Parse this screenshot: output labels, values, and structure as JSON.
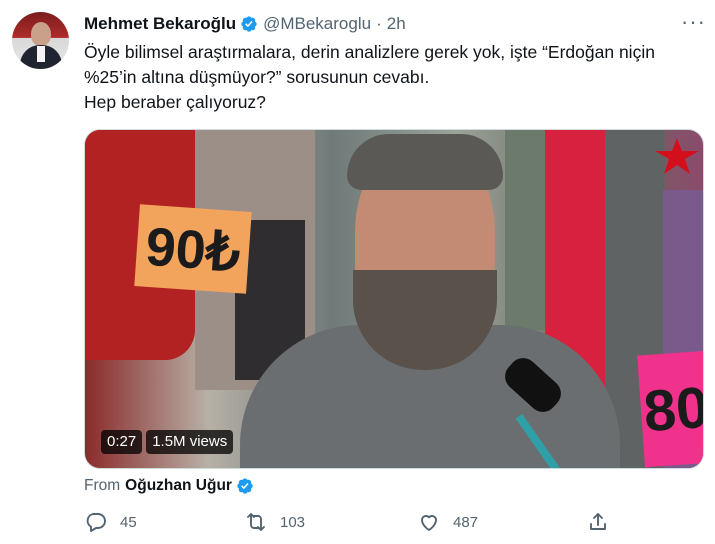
{
  "tweet": {
    "author_name": "Mehmet Bekaroğlu",
    "handle": "@MBekaroglu",
    "separator": "·",
    "time": "2h",
    "text_lines": [
      "Öyle bilimsel araştırmalara, derin analizlere gerek yok, işte “Erdoğan niçin",
      "%25’in altına düşmüyor?” sorusunun cevabı.",
      "Hep beraber çalıyoruz?"
    ]
  },
  "media": {
    "duration": "0:27",
    "views": "1.5M views",
    "tag_left": "90₺",
    "tag_right": "80"
  },
  "attribution": {
    "prefix": "From",
    "author": "Oğuzhan Uğur"
  },
  "actions": {
    "replies": "45",
    "retweets": "103",
    "likes": "487"
  },
  "colors": {
    "verified": "#1d9bf0",
    "secondary_text": "#536471",
    "primary_text": "#0f1419"
  }
}
